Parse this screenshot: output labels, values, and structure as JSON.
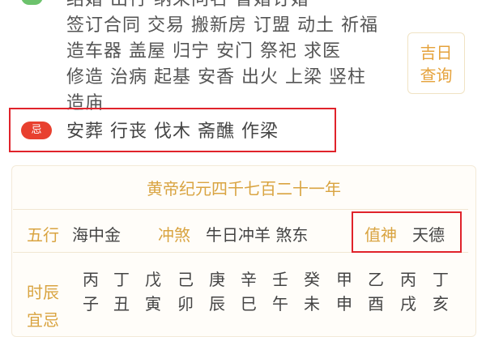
{
  "yi": {
    "lines": [
      "结婚  出行  纳采问名  冒婚订婚",
      "签订合同 交易 搬新房 订盟 动土 祈福",
      "造车器 盖屋 归宁 安门 祭祀 求医",
      "修造 治病 起基 安香 出火 上梁 竖柱",
      "造庙"
    ]
  },
  "query_button": {
    "line1": "吉日",
    "line2": "查询"
  },
  "ji": {
    "badge": "忌",
    "text": "安葬  行丧  伐木  斋醮  作梁"
  },
  "calendar": {
    "year_title": "黄帝纪元四千七百二十一年",
    "wuxing_label": "五行",
    "wuxing_value": "海中金",
    "chongsha_label": "冲煞",
    "chongsha_value": "牛日冲羊 煞东",
    "zhishen_label": "值神",
    "zhishen_value": "天德",
    "shichen_label": "时辰",
    "yiji_label": "宜忌",
    "hours": [
      {
        "stem": "丙",
        "branch": "子"
      },
      {
        "stem": "丁",
        "branch": "丑"
      },
      {
        "stem": "戊",
        "branch": "寅"
      },
      {
        "stem": "己",
        "branch": "卯"
      },
      {
        "stem": "庚",
        "branch": "辰"
      },
      {
        "stem": "辛",
        "branch": "巳"
      },
      {
        "stem": "壬",
        "branch": "午"
      },
      {
        "stem": "癸",
        "branch": "未"
      },
      {
        "stem": "甲",
        "branch": "申"
      },
      {
        "stem": "乙",
        "branch": "酉"
      },
      {
        "stem": "丙",
        "branch": "戌"
      },
      {
        "stem": "丁",
        "branch": "亥"
      }
    ]
  },
  "colors": {
    "accent": "#d9a441",
    "ji_red": "#e8402f",
    "highlight_box": "#e0232b"
  }
}
